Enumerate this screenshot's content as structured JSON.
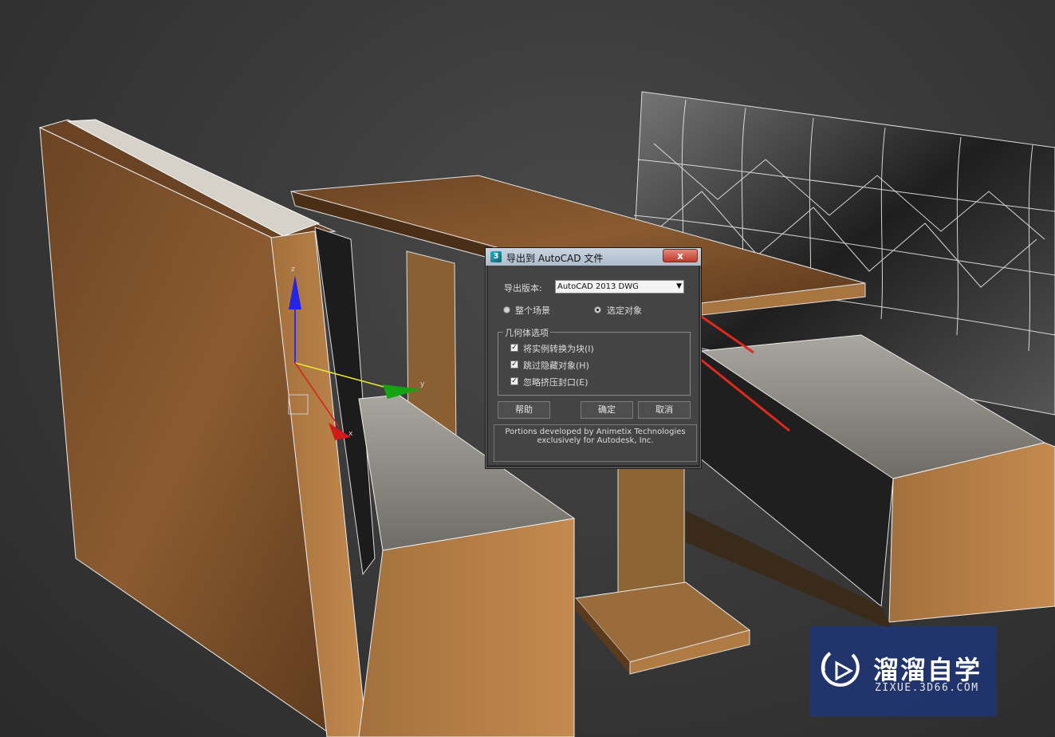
{
  "colors": {
    "wood": "#8a5a2e",
    "wood_dark": "#5e3a1c",
    "upholstery": "#2b2b2b",
    "cushion": "#8d8a84",
    "annotation_arrow": "#e0281e",
    "watermark_bg": "#203470"
  },
  "dialog": {
    "title": "导出到 AutoCAD 文件",
    "close_label": "x",
    "version_label": "导出版本:",
    "version_value": "AutoCAD 2013 DWG",
    "scope_options": [
      {
        "label": "整个场景",
        "selected": false
      },
      {
        "label": "选定对象",
        "selected": true
      }
    ],
    "geometry_group": "几何体选项",
    "checkboxes": [
      {
        "label": "将实例转换为块(I)",
        "checked": true
      },
      {
        "label": "跳过隐藏对象(H)",
        "checked": true
      },
      {
        "label": "忽略挤压封口(E)",
        "checked": true
      }
    ],
    "buttons": {
      "help": "帮助",
      "ok": "确定",
      "cancel": "取消"
    },
    "credits_line1": "Portions developed by Animetix Technologies",
    "credits_line2": "exclusively for Autodesk, Inc."
  },
  "gizmo": {
    "axis_z": "z",
    "axis_y": "y",
    "axis_x": "x"
  },
  "watermark": {
    "name": "溜溜自学",
    "url": "ZIXUE.3D66.COM",
    "icon": "play-logo-icon"
  }
}
